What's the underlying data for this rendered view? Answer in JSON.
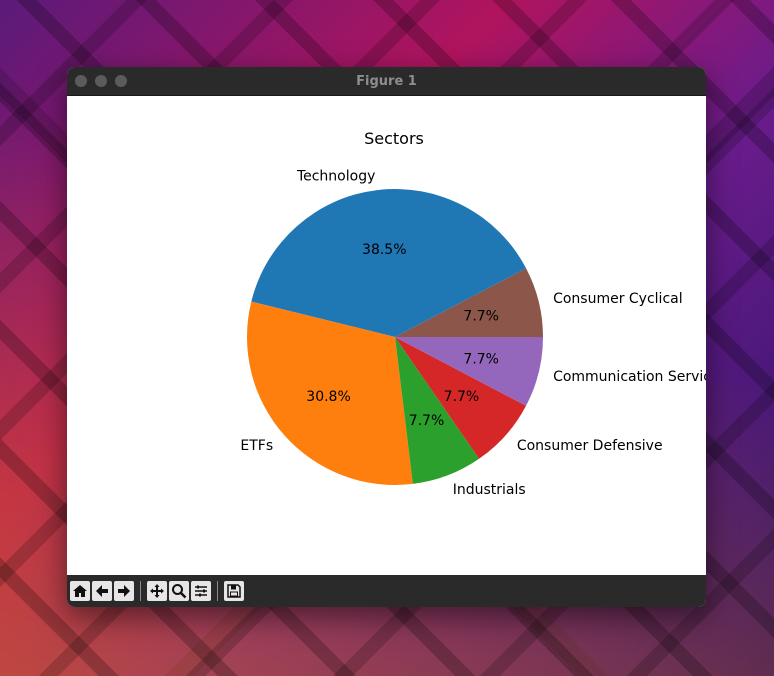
{
  "window": {
    "title": "Figure 1"
  },
  "toolbar": {
    "buttons": [
      "home-icon",
      "back-icon",
      "forward-icon",
      "pan-icon",
      "zoom-icon",
      "configure-icon",
      "save-icon"
    ]
  },
  "colors": {
    "technology": "#1f77b4",
    "etfs": "#ff7f0e",
    "industrials": "#2ca02c",
    "consumer_defensive": "#d62728",
    "communication_services": "#9467bd",
    "consumer_cyclical": "#8c564b"
  },
  "chart_data": {
    "type": "pie",
    "title": "Sectors",
    "categories": [
      "Consumer Cyclical",
      "Technology",
      "ETFs",
      "Industrials",
      "Consumer Defensive",
      "Communication Services"
    ],
    "values": [
      7.7,
      38.5,
      30.8,
      7.7,
      7.7,
      7.7
    ],
    "pct_labels": [
      "7.7%",
      "38.5%",
      "30.8%",
      "7.7%",
      "7.7%",
      "7.7%"
    ],
    "colors": [
      "#8c564b",
      "#1f77b4",
      "#ff7f0e",
      "#2ca02c",
      "#d62728",
      "#9467bd"
    ]
  }
}
